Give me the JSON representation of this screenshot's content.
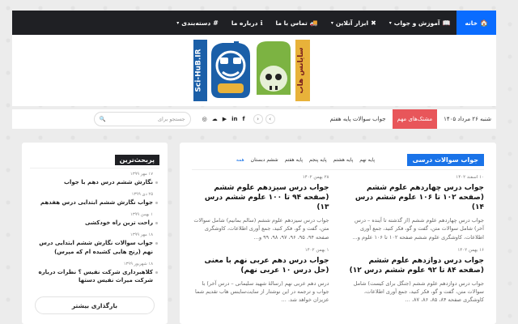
{
  "nav": {
    "items": [
      {
        "label": "خانه",
        "icon": "🏠",
        "dropdown": false,
        "active": true
      },
      {
        "label": "آموزش و جواب",
        "icon": "📖",
        "dropdown": true,
        "active": false
      },
      {
        "label": "ابزار آنلاین",
        "icon": "✖",
        "dropdown": true,
        "active": false
      },
      {
        "label": "تماس با ما",
        "icon": "🚚",
        "dropdown": false,
        "active": false
      },
      {
        "label": "درباره ما",
        "icon": "ℹ",
        "dropdown": false,
        "active": false
      },
      {
        "label": "دسته‌بندی",
        "icon": "#",
        "dropdown": true,
        "active": false
      }
    ],
    "chevron": "▾",
    "colors": {
      "bar": "#1f2024",
      "active": "#0a6cff"
    }
  },
  "logo": {
    "side_text_left": "Sci-HuB.IR",
    "side_text_right": "سایانس هاب"
  },
  "ticker": {
    "date": "شنبه ۲۶ مرداد ۱۴۰۵",
    "badge": "مشتک‌های مهم",
    "text": "جواب سوالات پایه هفتم",
    "prev": "‹",
    "next": "›",
    "socials": [
      "f",
      "in",
      "▶",
      "☁",
      "◎"
    ],
    "search_placeholder": "جستجو برای",
    "search_icon": "🔍"
  },
  "main": {
    "section_title": "جواب سوالات درسی",
    "tabs": [
      {
        "label": "همه",
        "active": true
      },
      {
        "label": "ششم دبستان",
        "active": false
      },
      {
        "label": "پایه هفتم",
        "active": false
      },
      {
        "label": "پایه پنجم",
        "active": false
      },
      {
        "label": "پایه هشتم",
        "active": false
      },
      {
        "label": "پایه نهم",
        "active": false
      }
    ],
    "posts": [
      {
        "date": "۱۰ اسفند ۱۴۰۲",
        "title": "جواب درس چهاردهم علوم ششم (صفحه ۱۰۲ تا ۱۰۶ علوم ششم درس ۱۴)",
        "excerpt": "جواب درس چهاردهم علوم ششم (از گذشته تا آینده – درس آخر) شامل سوالات متن، گفت و گو، فکر کنید، جمع آوری اطلاعات، کاوشگری علوم ششم صفحه ۱۰۲ تا ۱۰۶ علوم و…"
      },
      {
        "date": "۲۸ بهمن ۱۴۰۲",
        "title": "جواب درس سیزدهم علوم ششم (صفحه ۹۴ تا ۱۰۰ علوم ششم درس ۱۳)",
        "excerpt": "جواب درس سیزدهم علوم ششم (سالم بمانیم) شامل سوالات متن، گفت و گو، فکر کنید، جمع آوری اطلاعات، کاوشگری صفحه ۹۴، ۹۵، ۹۶، ۹۷، ۹۸، ۹۹ و…"
      },
      {
        "date": "۱۶ بهمن ۱۴۰۲",
        "title": "جواب درس دوازدهم علوم ششم (صفحه ۸۴ تا ۹۲ علوم ششم درس ۱۲)",
        "excerpt": "جواب درس دوازدهم علوم ششم (جنگل برای کیست) شامل سوالات متن، گفت و گو، فکر کنید، جمع آوری اطلاعات، کاوشگری صفحه ۸۴، ۸۵، ۸۶، ۸۷، …"
      },
      {
        "date": "۱ بهمن ۱۴۰۲",
        "title": "جواب درس دهم عربی نهم با معنی (حل درس ۱۰ عربی نهم)",
        "excerpt": "درس دهم عربی نهم (رسالهٔ شهید سلیمانی – درس آخر) با جواب و ترجمه در این نوشتار از سایت‌ساینس هاب تقدیم شما عزیزان خواهد شد. …"
      }
    ]
  },
  "sidebar": {
    "title": "پربحث‌ترین",
    "items": [
      {
        "date": "۱۷ مهر ۱۳۹۹",
        "title": "نگارش ششم درس دهم با جواب"
      },
      {
        "date": "۲۵ دی ۱۳۹۹",
        "title": "جواب نگارش ششم ابتدایی درس هفدهم"
      },
      {
        "date": "۱ بهمن ۱۳۹۹",
        "title": "راحت ترین راه خودکشی"
      },
      {
        "date": "۱۸ مهر ۱۳۹۹",
        "title": "جواب سوالات نگارش ششم ابتدایی درس نهم (رنج هایی کشیده ام که مپرس)"
      },
      {
        "date": "۱۸ شهریور ۱۳۹۹",
        "title": "کلاهبرداری شرکت نفیس ؟ نظرات درباره شرکت میراث نفیس دستها"
      }
    ],
    "load_more": "بارگذاری بیشتر"
  }
}
